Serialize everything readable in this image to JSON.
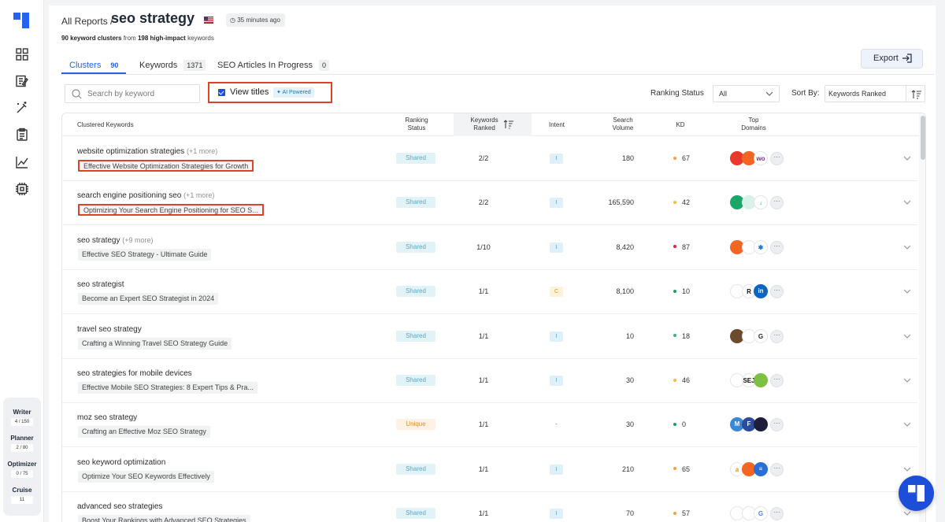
{
  "sidebar": {
    "nav": [
      "dashboard-icon",
      "edit-icon",
      "magic-wand-icon",
      "clipboard-icon",
      "chart-icon",
      "settings-icon"
    ],
    "usage": [
      {
        "name": "Writer",
        "count": "4 / 150"
      },
      {
        "name": "Planner",
        "count": "2 / 80"
      },
      {
        "name": "Optimizer",
        "count": "0 / 75"
      },
      {
        "name": "Cruise",
        "count": "11"
      }
    ]
  },
  "header": {
    "breadcrumb": "All Reports /",
    "title": "seo strategy",
    "time_ago": "35 minutes ago",
    "subtitle": {
      "cluster_count": "90 keyword clusters",
      "from_text": " from ",
      "keyword_count": "198 high-impact",
      "suffix": " keywords"
    }
  },
  "tabs": [
    {
      "label": "Clusters",
      "count": "90",
      "active": true
    },
    {
      "label": "Keywords",
      "count": "1371",
      "active": false
    },
    {
      "label": "SEO Articles In Progress",
      "count": "0",
      "active": false
    }
  ],
  "toolbar": {
    "export_label": "Export",
    "search_placeholder": "Search by keyword",
    "view_titles_label": "View titles",
    "ai_badge": "AI Powered",
    "ranking_status_label": "Ranking Status",
    "ranking_status_value": "All",
    "sort_by_label": "Sort By:",
    "sort_by_value": "Keywords Ranked"
  },
  "table": {
    "headers": {
      "clustered_keywords": "Clustered Keywords",
      "ranking_status_1": "Ranking",
      "ranking_status_2": "Status",
      "keywords_ranked_1": "Keywords",
      "keywords_ranked_2": "Ranked",
      "intent": "Intent",
      "search_volume_1": "Search",
      "search_volume_2": "Volume",
      "kd": "KD",
      "top_domains_1": "Top",
      "top_domains_2": "Domains"
    },
    "rows": [
      {
        "keyword": "website optimization strategies",
        "more": "(+1 more)",
        "title": "Effective Website Optimization Strategies for Growth",
        "status": "Shared",
        "ranked": "2/2",
        "intent": "I",
        "volume": "180",
        "kd": "67",
        "kd_color": "#f59e42"
      },
      {
        "keyword": "search engine positioning seo",
        "more": "(+1 more)",
        "title": "Optimizing Your Search Engine Positioning for SEO S...",
        "status": "Shared",
        "ranked": "2/2",
        "intent": "I",
        "volume": "165,590",
        "kd": "42",
        "kd_color": "#f5b942"
      },
      {
        "keyword": "seo strategy",
        "more": "(+9 more)",
        "title": "Effective SEO Strategy - Ultimate Guide",
        "status": "Shared",
        "ranked": "1/10",
        "intent": "I",
        "volume": "8,420",
        "kd": "87",
        "kd_color": "#e0243a"
      },
      {
        "keyword": "seo strategist",
        "more": "",
        "title": "Become an Expert SEO Strategist in 2024",
        "status": "Shared",
        "ranked": "1/1",
        "intent": "C",
        "volume": "8,100",
        "kd": "10",
        "kd_color": "#1e9e5a"
      },
      {
        "keyword": "travel seo strategy",
        "more": "",
        "title": "Crafting a Winning Travel SEO Strategy Guide",
        "status": "Shared",
        "ranked": "1/1",
        "intent": "I",
        "volume": "10",
        "kd": "18",
        "kd_color": "#3cb371"
      },
      {
        "keyword": "seo strategies for mobile devices",
        "more": "",
        "title": "Effective Mobile SEO Strategies: 8 Expert Tips & Pra...",
        "status": "Shared",
        "ranked": "1/1",
        "intent": "I",
        "volume": "30",
        "kd": "46",
        "kd_color": "#f5b942"
      },
      {
        "keyword": "moz seo strategy",
        "more": "",
        "title": "Crafting an Effective Moz SEO Strategy",
        "status": "Unique",
        "ranked": "1/1",
        "intent": "-",
        "volume": "30",
        "kd": "0",
        "kd_color": "#1e9e5a"
      },
      {
        "keyword": "seo keyword optimization",
        "more": "",
        "title": "Optimize Your SEO Keywords Effectively",
        "status": "Shared",
        "ranked": "1/1",
        "intent": "I",
        "volume": "210",
        "kd": "65",
        "kd_color": "#f59e42"
      },
      {
        "keyword": "advanced seo strategies",
        "more": "",
        "title": "Boost Your Rankings with Advanced SEO Strategies",
        "status": "Shared",
        "ranked": "1/1",
        "intent": "I",
        "volume": "70",
        "kd": "57",
        "kd_color": "#f59e42"
      }
    ],
    "domain_icons": [
      [
        {
          "label": "",
          "color": "#e8392b"
        },
        {
          "label": "",
          "color": "#f26522"
        },
        {
          "label": "wo",
          "color": "#ffffff",
          "text": "#7a2ea0"
        }
      ],
      [
        {
          "label": "",
          "color": "#1aa86a"
        },
        {
          "label": "",
          "color": "#d8f2e6",
          "text": "#1a8a5a"
        },
        {
          "label": "↓",
          "color": "#ffffff",
          "text": "#2aa4d8"
        }
      ],
      [
        {
          "label": "",
          "color": "#f26522"
        },
        {
          "label": "",
          "color": "#ffffff",
          "text": "#f26522"
        },
        {
          "label": "✱",
          "color": "#ffffff",
          "text": "#1e73e8"
        }
      ],
      [
        {
          "label": "",
          "color": "#ffffff",
          "text": "#f26522"
        },
        {
          "label": "R",
          "color": "#ffffff",
          "text": "#111"
        },
        {
          "label": "in",
          "color": "#0a66c2"
        }
      ],
      [
        {
          "label": "",
          "color": "#6b4a2e"
        },
        {
          "label": "",
          "color": "#ffffff",
          "text": "#f26522"
        },
        {
          "label": "G",
          "color": "#ffffff",
          "text": "#222"
        }
      ],
      [
        {
          "label": "",
          "color": "#ffffff",
          "text": "#f26522"
        },
        {
          "label": "SEJ",
          "color": "#ffffff",
          "text": "#111"
        },
        {
          "label": "",
          "color": "#7cc142"
        }
      ],
      [
        {
          "label": "M",
          "color": "#3a86d8"
        },
        {
          "label": "F",
          "color": "#2a4c9a"
        },
        {
          "label": "",
          "color": "#1e1e3a"
        }
      ],
      [
        {
          "label": "a",
          "color": "#ffffff",
          "text": "#f28c1e"
        },
        {
          "label": "",
          "color": "#f26522"
        },
        {
          "label": "≡",
          "color": "#2a6fd8"
        }
      ],
      [
        {
          "label": "",
          "color": "#ffffff",
          "text": "#f26522"
        },
        {
          "label": "",
          "color": "#ffffff",
          "text": "#2aa45a"
        },
        {
          "label": "G",
          "color": "#ffffff",
          "text": "#4285f4"
        }
      ]
    ]
  },
  "colors": {
    "accent": "#2563eb",
    "highlight_border": "#d9432c"
  }
}
